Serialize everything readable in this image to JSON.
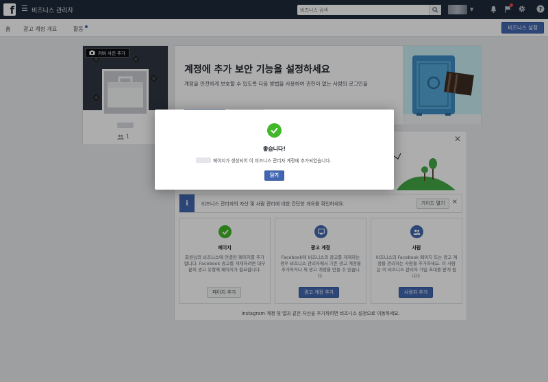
{
  "header": {
    "app_title": "비즈니스 관리자",
    "search_placeholder": "비즈니스 검색"
  },
  "nav": {
    "home": "홈",
    "ad_account_overview": "광고 계정 개요",
    "activity": "활동",
    "settings_button": "비즈니스 설정"
  },
  "left_card": {
    "cover_button": "커버 사진 추가",
    "member_count": "1"
  },
  "security": {
    "title": "계정에 추가 보안 기능을 설정하세요",
    "description": "계정을 안전하게 보호할 수 있도록 다음 방법을 사용하여 권한이 없는 사람의 로그인을"
  },
  "info_bar": {
    "text": "비즈니스 관리자의 자산 및 사람 관리에 대한 간단한 개요를 확인하세요.",
    "guide_button": "가이드 열기"
  },
  "columns": [
    {
      "title": "페이지",
      "description": "회원님의 비즈니스에 연결된 페이지를 추가합니다. Facebook 광고를 게재하려면 대부분의 광고 유형에 페이지가 필요합니다.",
      "button": "페이지 추가"
    },
    {
      "title": "광고 계정",
      "description": "Facebook에 비즈니스의 광고를 게재하는 경우 비즈니스 관리자에서 기존 광고 계정을 추가하거나 새 광고 계정을 만들 수 있습니다.",
      "button": "광고 계정 추가"
    },
    {
      "title": "사람",
      "description": "비즈니스의 Facebook 페이지 또는 광고 계정을 관리하는 사람을 추가하세요. 이 사람은 이 비즈니스 관리자 가입 초대를 받게 됩니다.",
      "button": "사용자 추가"
    }
  ],
  "footnote": "Instagram 계정 및 앱과 같은 자산을 추가하려면 비즈니스 설정으로 이동하세요.",
  "modal": {
    "title": "좋습니다!",
    "message": "페이지가 생성되어 이 비즈니스 관리자 계정에 추가되었습니다.",
    "close_button": "닫기"
  },
  "icons": {
    "logo": "facebook-logo",
    "menu": "hamburger-icon",
    "search": "search-icon",
    "notifications": "bell-icon",
    "flag": "flag-icon",
    "settings": "gear-icon",
    "help": "help-icon",
    "camera": "camera-icon",
    "people": "people-icon",
    "info": "info-icon",
    "check": "check-icon"
  },
  "colors": {
    "brand_blue": "#4267b2",
    "success_green": "#42b72a",
    "topbar": "#1c2a3a"
  }
}
